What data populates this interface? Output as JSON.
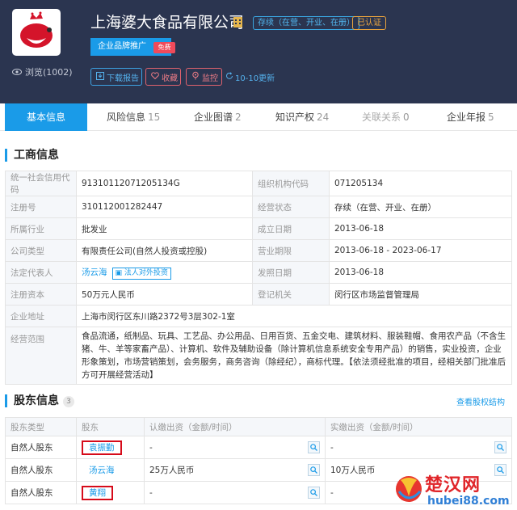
{
  "company": {
    "name": "上海婆大食品有限公司",
    "status_badge": "存续（在营、开业、在册）",
    "verified_badge": "已认证",
    "views": "浏览(1002)"
  },
  "promo": {
    "label": "企业品牌推广",
    "free": "免费"
  },
  "actions": {
    "download": "下载报告",
    "favorite": "收藏",
    "monitor": "监控",
    "updated": "10-10更新"
  },
  "tabs": [
    {
      "label": "基本信息",
      "count": ""
    },
    {
      "label": "风险信息",
      "count": "15"
    },
    {
      "label": "企业图谱",
      "count": "2"
    },
    {
      "label": "知识产权",
      "count": "24"
    },
    {
      "label": "关联关系",
      "count": "0"
    },
    {
      "label": "企业年报",
      "count": "5"
    }
  ],
  "business": {
    "title": "工商信息",
    "rows": [
      [
        "统一社会信用代码",
        "91310112071205134G",
        "组织机构代码",
        "071205134"
      ],
      [
        "注册号",
        "310112001282447",
        "经营状态",
        "存续（在营、开业、在册）"
      ],
      [
        "所属行业",
        "批发业",
        "成立日期",
        "2013-06-18"
      ],
      [
        "公司类型",
        "有限责任公司(自然人投资或控股)",
        "营业期限",
        "2013-06-18 - 2023-06-17"
      ],
      [
        "法定代表人",
        "汤云海",
        "发照日期",
        "2013-06-18"
      ],
      [
        "注册资本",
        "50万元人民币",
        "登记机关",
        "闵行区市场监督管理局"
      ]
    ],
    "legal_rep_tag": "法人对外投资",
    "address_label": "企业地址",
    "address": "上海市闵行区东川路2372号3层302-1室",
    "scope_label": "经营范围",
    "scope": "食品流通，纸制品、玩具、工艺品、办公用品、日用百货、五金交电、建筑材料、服装鞋帽、食用农产品（不含生猪、牛、羊等家畜产品）、计算机、软件及辅助设备（除计算机信息系统安全专用产品）的销售，实业投资，企业形象策划，市场营销策划，会务服务，商务咨询（除经纪），商标代理。【依法须经批准的项目，经相关部门批准后方可开展经营活动】"
  },
  "shareholders": {
    "title": "股东信息",
    "count": "3",
    "view_link": "查看股权结构",
    "headers": [
      "股东类型",
      "股东",
      "认缴出资（金额/时间）",
      "实缴出资（金额/时间）"
    ],
    "rows": [
      {
        "type": "自然人股东",
        "name": "袁振勤",
        "subscribed": "-",
        "paid": "-"
      },
      {
        "type": "自然人股东",
        "name": "汤云海",
        "subscribed": "25万人民币",
        "paid": "10万人民币"
      },
      {
        "type": "自然人股东",
        "name": "黄翔",
        "subscribed": "-",
        "paid": "-"
      }
    ]
  },
  "watermark": {
    "text": "楚汉网",
    "url": "hubei88.com"
  },
  "colors": {
    "header_bg": "#2b3550",
    "accent": "#1a9be8",
    "highlight": "#d60b1a"
  }
}
